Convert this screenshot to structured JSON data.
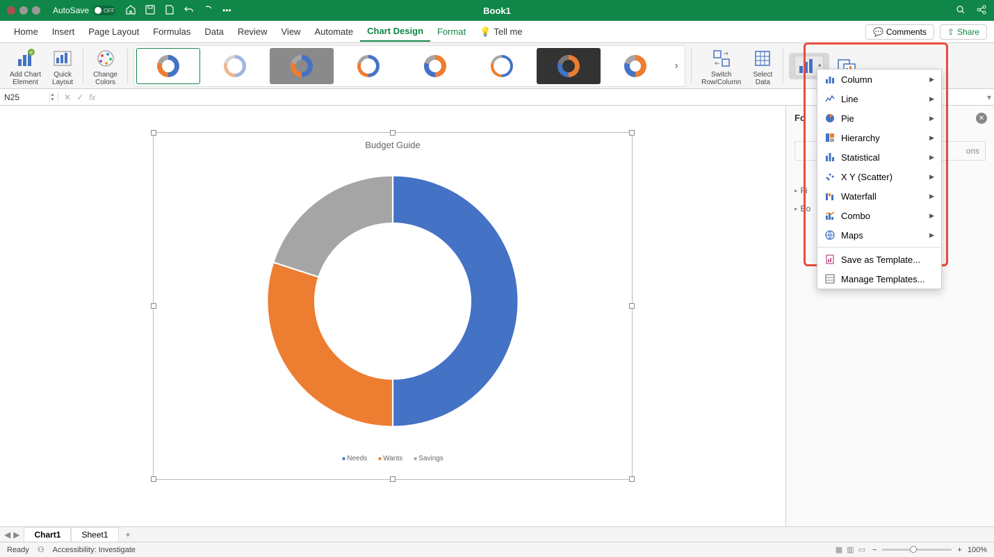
{
  "titlebar": {
    "autosave": "AutoSave",
    "autosave_state": "OFF",
    "title": "Book1"
  },
  "tabs": [
    "Home",
    "Insert",
    "Page Layout",
    "Formulas",
    "Data",
    "Review",
    "View",
    "Automate",
    "Chart Design",
    "Format",
    "Tell me"
  ],
  "active_tab": "Chart Design",
  "ribbon": {
    "add_element": "Add Chart\nElement",
    "quick": "Quick\nLayout",
    "colors": "Change\nColors",
    "switch": "Switch\nRow/Column",
    "select": "Select\nData"
  },
  "buttons": {
    "comments": "Comments",
    "share": "Share"
  },
  "namebox": "N25",
  "side": {
    "title_partial": "Fo",
    "options_partial": "ons",
    "fill": "Fi",
    "border": "Bo"
  },
  "sheets": {
    "chart": "Chart1",
    "sheet": "Sheet1"
  },
  "status": {
    "ready": "Ready",
    "access": "Accessibility: Investigate",
    "zoom": "100%"
  },
  "menu": {
    "column": "Column",
    "line": "Line",
    "pie": "Pie",
    "hierarchy": "Hierarchy",
    "statistical": "Statistical",
    "scatter": "X Y (Scatter)",
    "waterfall": "Waterfall",
    "combo": "Combo",
    "maps": "Maps",
    "save_template": "Save as Template...",
    "manage_templates": "Manage Templates..."
  },
  "chart_data": {
    "type": "pie",
    "title": "Budget Guide",
    "categories": [
      "Needs",
      "Wants",
      "Savings"
    ],
    "values": [
      50,
      30,
      20
    ],
    "colors": [
      "#4472C4",
      "#ED7D31",
      "#A5A5A5"
    ],
    "hole": 0.62,
    "legend_position": "bottom"
  }
}
